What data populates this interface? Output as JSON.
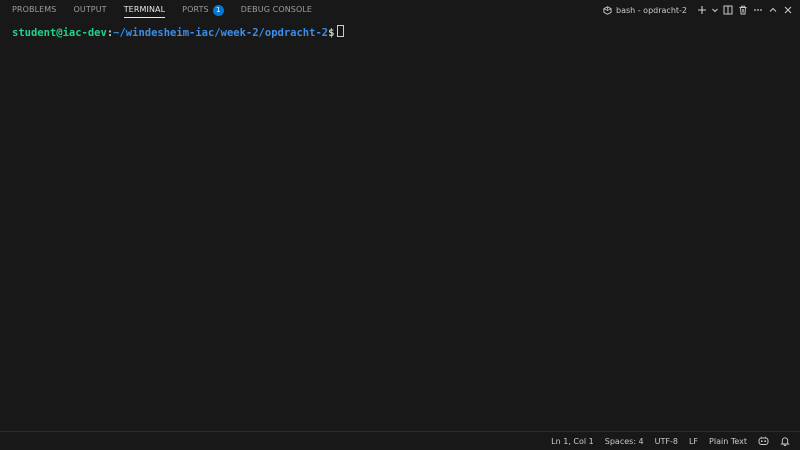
{
  "tabs": [
    {
      "label": "PROBLEMS",
      "active": false
    },
    {
      "label": "OUTPUT",
      "active": false
    },
    {
      "label": "TERMINAL",
      "active": true
    },
    {
      "label": "PORTS",
      "active": false,
      "badge": "1"
    },
    {
      "label": "DEBUG CONSOLE",
      "active": false
    }
  ],
  "terminal_header": {
    "name": "bash - opdracht-2",
    "icons": [
      "terminal-icon",
      "add-icon",
      "chevron-down-icon",
      "split-icon",
      "trash-icon",
      "more-icon",
      "maximize-icon",
      "close-icon"
    ]
  },
  "terminal": {
    "user_host": "student@iac-dev",
    "colon": ":",
    "path": "~/windesheim-iac/week-2/opdracht-2",
    "dollar": "$"
  },
  "statusbar": {
    "position": "Ln 1, Col 1",
    "spaces": "Spaces: 4",
    "encoding": "UTF-8",
    "eol": "LF",
    "language": "Plain Text",
    "icons": [
      "copilot-icon",
      "bell-icon"
    ]
  },
  "colors": {
    "background": "#181818",
    "accent": "#0078d4",
    "prompt_user": "#23d18b",
    "prompt_path": "#3b8eea"
  }
}
